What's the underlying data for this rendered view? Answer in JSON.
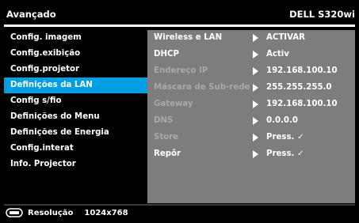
{
  "header": {
    "title": "Avançado",
    "model": "DELL S320wi"
  },
  "menu": {
    "items": [
      {
        "label": "Config. imagem"
      },
      {
        "label": "Config.exibição"
      },
      {
        "label": "Config.projetor"
      },
      {
        "label": "Definições da LAN"
      },
      {
        "label": "Config s/fio"
      },
      {
        "label": "Definições do Menu"
      },
      {
        "label": "Definições de Energia"
      },
      {
        "label": "Config.interat"
      },
      {
        "label": "Info. Projector"
      }
    ],
    "selected_index": 3
  },
  "settings": {
    "rows": [
      {
        "label": "Wireless e LAN",
        "value": "ACTIVAR"
      },
      {
        "label": "DHCP",
        "value": "Activ"
      },
      {
        "label": "Endereço IP",
        "value": "192.168.100.10"
      },
      {
        "label": "Máscara de Sub-rede",
        "value": "255.255.255.0"
      },
      {
        "label": "Gateway",
        "value": "192.168.100.10"
      },
      {
        "label": "DNS",
        "value": "0.0.0.0"
      },
      {
        "label": "Store",
        "value": "Press. ✓"
      },
      {
        "label": "Repôr",
        "value": "Press. ✓"
      }
    ]
  },
  "footer": {
    "source_icon": "input-source-icon",
    "resolution_label": "Resolução",
    "resolution_value": "1024x768"
  },
  "colors": {
    "background": "#000000",
    "selected_menu": "#009fe3",
    "panel": "#7d7d7d",
    "disabled_text": "#a9a9a9",
    "text": "#ffffff"
  }
}
